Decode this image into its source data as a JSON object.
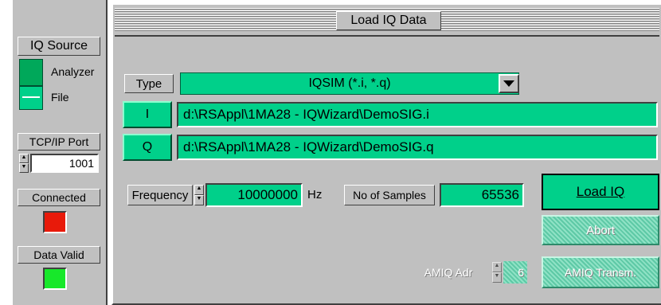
{
  "left_panel": {
    "iq_source_label": "IQ Source",
    "analyzer_label": "Analyzer",
    "file_label": "File",
    "tcp_label": "TCP/IP Port",
    "port_value": "1001",
    "connected_label": "Connected",
    "data_valid_label": "Data Valid",
    "colors": {
      "connected": "#e81a0a",
      "data_valid": "#17e82a"
    }
  },
  "main": {
    "title": "Load IQ Data",
    "type_label": "Type",
    "type_value": "IQSIM (*.i, *.q)",
    "i_label": "I",
    "i_path": "d:\\RSAppl\\1MA28 - IQWizard\\DemoSIG.i",
    "q_label": "Q",
    "q_path": "d:\\RSAppl\\1MA28 - IQWizard\\DemoSIG.q",
    "frequency_label": "Frequency",
    "frequency_value": "10000000",
    "frequency_unit": "Hz",
    "samples_label": "No of Samples",
    "samples_value": "65536",
    "load_iq_label": "Load IQ",
    "abort_label": "Abort",
    "amiq_adr_label": "AMIQ Adr",
    "amiq_adr_value": "6",
    "amiq_transm_label": "AMIQ Transm."
  },
  "colors": {
    "accent": "#00d08a",
    "panel": "#c0c0c0"
  }
}
